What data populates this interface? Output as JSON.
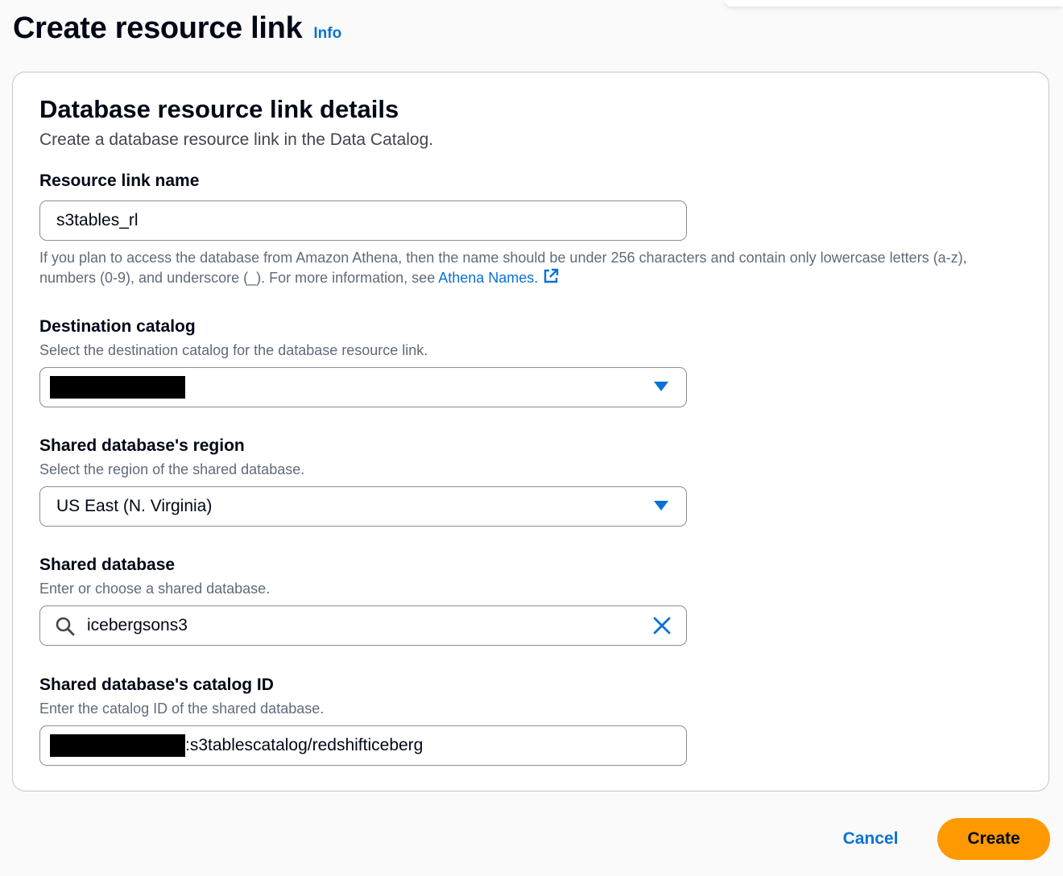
{
  "header": {
    "title": "Create resource link",
    "info_label": "Info"
  },
  "section": {
    "title": "Database resource link details",
    "description": "Create a database resource link in the Data Catalog."
  },
  "resource_link_name": {
    "label": "Resource link name",
    "value": "s3tables_rl",
    "hint_text": "If you plan to access the database from Amazon Athena, then the name should be under 256 characters and contain only lowercase letters (a-z), numbers (0-9), and underscore (_). For more information, see ",
    "hint_link": "Athena Names."
  },
  "destination_catalog": {
    "label": "Destination catalog",
    "description": "Select the destination catalog for the database resource link.",
    "value_redacted": true,
    "icon": "caret-down-icon"
  },
  "shared_region": {
    "label": "Shared database's region",
    "description": "Select the region of the shared database.",
    "value": "US East (N. Virginia)",
    "icon": "caret-down-icon"
  },
  "shared_database": {
    "label": "Shared database",
    "description": "Enter or choose a shared database.",
    "value": "icebergsons3",
    "icons": [
      "search-icon",
      "clear-icon"
    ]
  },
  "shared_catalog_id": {
    "label": "Shared database's catalog ID",
    "description": "Enter the catalog ID of the shared database.",
    "value_suffix": ":s3tablescatalog/redshifticeberg",
    "value_prefix_redacted": true
  },
  "footer": {
    "cancel_label": "Cancel",
    "create_label": "Create"
  },
  "colors": {
    "link_blue": "#0972d3",
    "primary_orange": "#ff9900",
    "text_dark": "#000716",
    "text_muted": "#5f6b7a",
    "border": "#8c8c94"
  }
}
